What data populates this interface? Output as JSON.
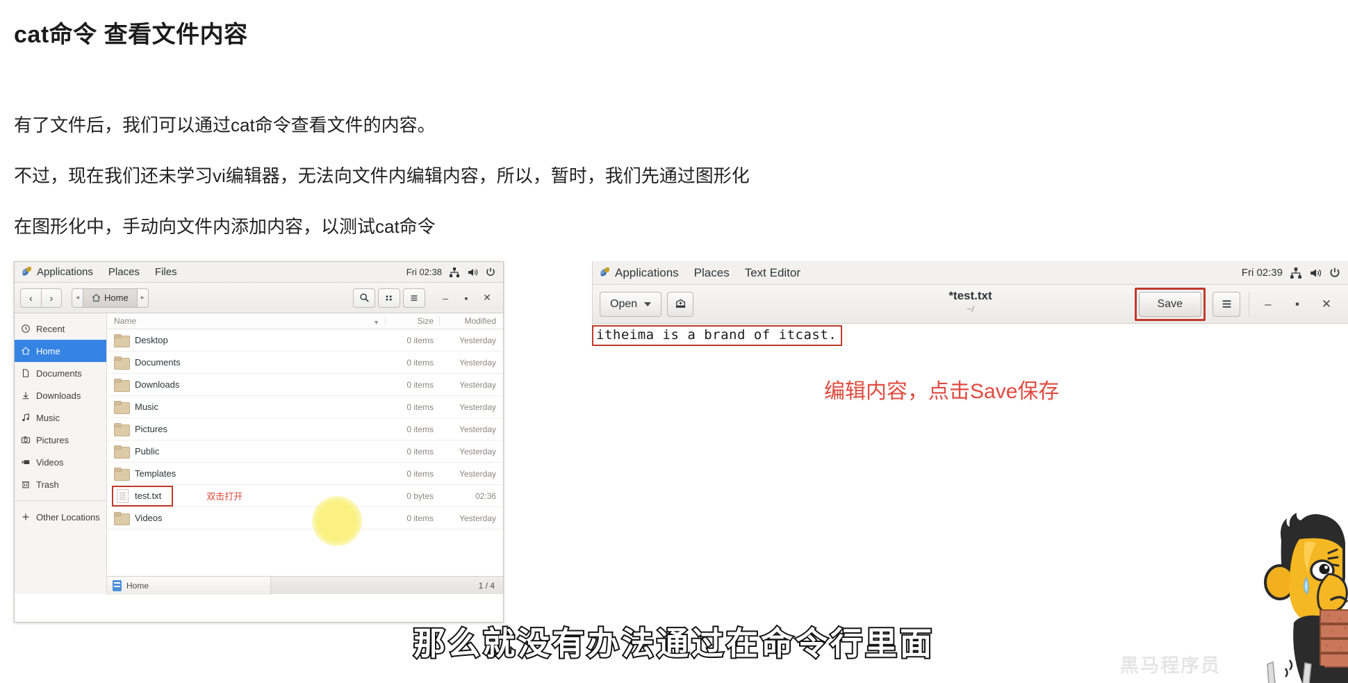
{
  "lesson": {
    "title": "cat命令 查看文件内容",
    "lines": [
      "有了文件后，我们可以通过cat命令查看文件的内容。",
      "不过，现在我们还未学习vi编辑器，无法向文件内编辑内容，所以，暂时，我们先通过图形化",
      "在图形化中，手动向文件内添加内容，以测试cat命令"
    ]
  },
  "files_window": {
    "topbar": {
      "applications": "Applications",
      "places": "Places",
      "app_name": "Files",
      "clock": "Fri 02:38"
    },
    "breadcrumb": {
      "left_arrow": "◂",
      "home": "Home",
      "right_arrow": "▸"
    },
    "columns": {
      "name": "Name",
      "size": "Size",
      "modified": "Modified"
    },
    "sidebar": [
      {
        "label": "Recent",
        "icon": "clock-icon"
      },
      {
        "label": "Home",
        "icon": "home-icon"
      },
      {
        "label": "Documents",
        "icon": "document-icon"
      },
      {
        "label": "Downloads",
        "icon": "download-icon"
      },
      {
        "label": "Music",
        "icon": "music-icon"
      },
      {
        "label": "Pictures",
        "icon": "camera-icon"
      },
      {
        "label": "Videos",
        "icon": "video-icon"
      },
      {
        "label": "Trash",
        "icon": "trash-icon"
      },
      {
        "label": "Other Locations",
        "icon": "plus-icon"
      }
    ],
    "rows": [
      {
        "name": "Desktop",
        "size": "0 items",
        "modified": "Yesterday",
        "type": "folder"
      },
      {
        "name": "Documents",
        "size": "0 items",
        "modified": "Yesterday",
        "type": "folder"
      },
      {
        "name": "Downloads",
        "size": "0 items",
        "modified": "Yesterday",
        "type": "folder"
      },
      {
        "name": "Music",
        "size": "0 items",
        "modified": "Yesterday",
        "type": "folder"
      },
      {
        "name": "Pictures",
        "size": "0 items",
        "modified": "Yesterday",
        "type": "folder"
      },
      {
        "name": "Public",
        "size": "0 items",
        "modified": "Yesterday",
        "type": "folder"
      },
      {
        "name": "Templates",
        "size": "0 items",
        "modified": "Yesterday",
        "type": "folder"
      },
      {
        "name": "test.txt",
        "size": "0 bytes",
        "modified": "02:36",
        "type": "file",
        "hint": "双击打开"
      },
      {
        "name": "Videos",
        "size": "0 items",
        "modified": "Yesterday",
        "type": "folder"
      }
    ],
    "statusbar": {
      "tab_label": "Home",
      "pages": "1 / 4"
    }
  },
  "editor_window": {
    "topbar": {
      "applications": "Applications",
      "places": "Places",
      "app_name": "Text Editor",
      "clock": "Fri 02:39"
    },
    "open_button": "Open",
    "title": "*test.txt",
    "subtitle": "~/",
    "save_button": "Save",
    "document_text": "itheima is a brand of itcast."
  },
  "annotation": "编辑内容，点击Save保存",
  "subtitle_caption": "那么就没有办法通过在命令行里面",
  "watermark": "黑马程序员",
  "colors": {
    "accent_blue": "#3584e4",
    "red_box": "#c0392b",
    "annotation_red": "#e04a3f",
    "highlight_yellow": "#faf078"
  }
}
